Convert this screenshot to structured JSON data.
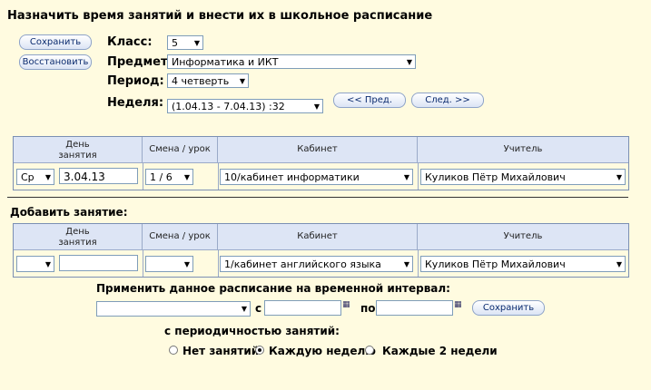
{
  "title": "Назначить время занятий и внести их в школьное расписание",
  "buttons": {
    "save": "Сохранить",
    "restore": "Восстановить",
    "prev": "<< Пред.",
    "next": "След. >>",
    "save2": "Сохранить"
  },
  "filters": {
    "class_label": "Класс:",
    "class_value": "5",
    "subject_label": "Предмет:",
    "subject_value": "Информатика и ИКТ",
    "period_label": "Период:",
    "period_value": "4 четверть",
    "week_label": "Неделя:",
    "week_value": "(1.04.13 - 7.04.13) :32"
  },
  "table": {
    "headers": [
      "День\nзанятия",
      "Смена / урок",
      "Кабинет",
      "Учитель"
    ],
    "row": {
      "day": "Ср",
      "date": "3.04.13",
      "shift": "1 / 6",
      "room": "10/кабинет информатики",
      "teacher": "Куликов Пётр Михайлович"
    }
  },
  "add": {
    "label": "Добавить занятие:",
    "headers": [
      "День\nзанятия",
      "Смена / урок",
      "Кабинет",
      "Учитель"
    ],
    "row": {
      "day": "",
      "date": "",
      "shift": "",
      "room": "1/кабинет английского языка",
      "teacher": "Куликов Пётр Михайлович"
    }
  },
  "apply": {
    "label": "Применить данное расписание на временной интервал:",
    "from": "с",
    "to": "по",
    "periodicity_label": "с периодичностью занятий:",
    "options": [
      "Нет занятий",
      "Каждую неделю",
      "Каждые 2 недели"
    ],
    "selected_index": 1
  },
  "colors": {
    "background": "#fffbe0",
    "header_bg": "#dde5f5",
    "border": "#7b8fb3"
  }
}
